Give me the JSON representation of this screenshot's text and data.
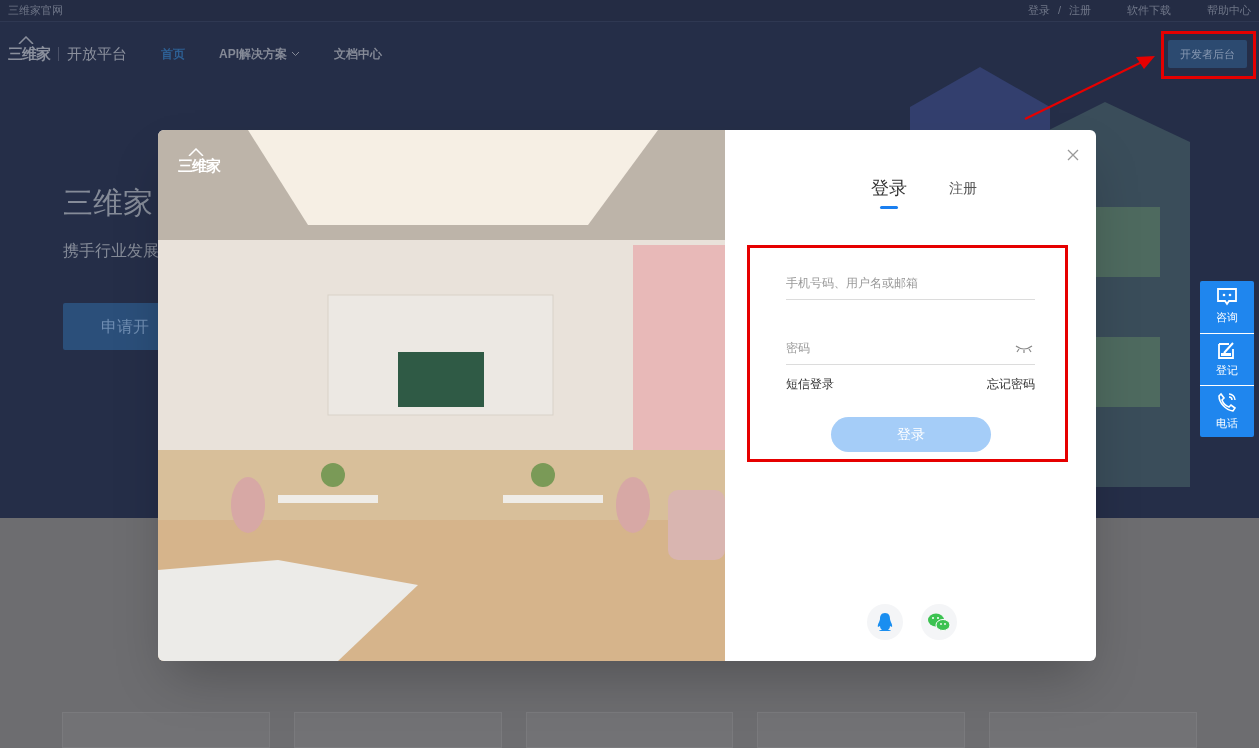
{
  "top_bar": {
    "site_link": "三维家官网",
    "login": "登录",
    "separator": "/",
    "register": "注册",
    "links": [
      "软件下载",
      "帮助中心"
    ]
  },
  "nav": {
    "logo_text": "三维家",
    "platform": "开放平台",
    "items": [
      {
        "label": "首页",
        "selected": true,
        "dropdown": false
      },
      {
        "label": "API解决方案",
        "selected": false,
        "dropdown": true
      },
      {
        "label": "文档中心",
        "selected": false,
        "dropdown": false
      }
    ],
    "console_button": "开发者后台"
  },
  "hero": {
    "title": "三维家",
    "subtitle": "携手行业发展",
    "button": "申请开"
  },
  "modal": {
    "logo_text": "三维家",
    "tabs": [
      {
        "label": "登录",
        "selected": true
      },
      {
        "label": "注册",
        "selected": false
      }
    ],
    "fields": [
      {
        "kind": "text",
        "placeholder": "手机号码、用户名或邮箱"
      },
      {
        "kind": "password",
        "placeholder": "密码"
      }
    ],
    "sms_login": "短信登录",
    "forgot_password": "忘记密码",
    "submit": {
      "label": "登录",
      "disabled": true
    },
    "social": [
      {
        "kind": "qq"
      },
      {
        "kind": "wechat"
      }
    ]
  },
  "side_buttons": [
    {
      "kind": "chat",
      "label": "咨询"
    },
    {
      "kind": "edit",
      "label": "登记"
    },
    {
      "kind": "phone",
      "label": "电话"
    }
  ]
}
